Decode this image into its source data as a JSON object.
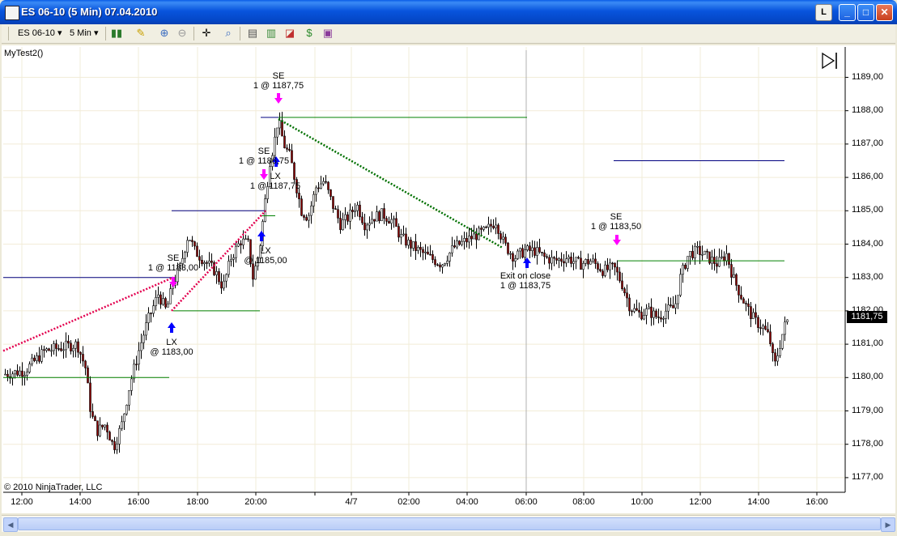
{
  "window": {
    "title": "ES 06-10 (5 Min)  07.04.2010",
    "lock_btn": "L"
  },
  "toolbar": {
    "instrument": "ES 06-10",
    "interval": "5 Min"
  },
  "chart": {
    "strategy_label": "MyTest2()",
    "copyright": "© 2010 NinjaTrader, LLC",
    "last_price": "1181,75",
    "price_ticks": [
      "1189,00",
      "1188,00",
      "1187,00",
      "1186,00",
      "1185,00",
      "1184,00",
      "1183,00",
      "1182,00",
      "1181,00",
      "1180,00",
      "1179,00",
      "1178,00",
      "1177,00"
    ],
    "time_ticks": [
      "12:00",
      "14:00",
      "16:00",
      "18:00",
      "20:00",
      "4/7",
      "02:00",
      "04:00",
      "06:00",
      "08:00",
      "10:00",
      "12:00",
      "14:00",
      "16:00"
    ],
    "annotations": {
      "se1_top": "SE",
      "se1_bot": "1 @ 1187,75",
      "se2_top": "SE",
      "se2_bot": "1 @ 1186,75",
      "lx2_top": "LX",
      "lx2_bot": "1 @ 1187,75",
      "lx3_top": "LX",
      "lx3_bot": "@ 1185,00",
      "se3_top": "SE",
      "se3_bot": "1 @ 1183,00",
      "lx1_top": "LX",
      "lx1_bot": "@ 1183,00",
      "exit_top": "Exit on close",
      "exit_bot": "1 @ 1183,75",
      "se4_top": "SE",
      "se4_bot": "1 @ 1183,50"
    },
    "colors": {
      "up": "#ffffff",
      "down": "#8b0000",
      "long_line": "#008000",
      "short_line": "#000080",
      "loss_dots": "#e3004f",
      "win_dots": "#007000",
      "long_arrow": "#0000ff",
      "short_arrow": "#ff00ff"
    }
  }
}
